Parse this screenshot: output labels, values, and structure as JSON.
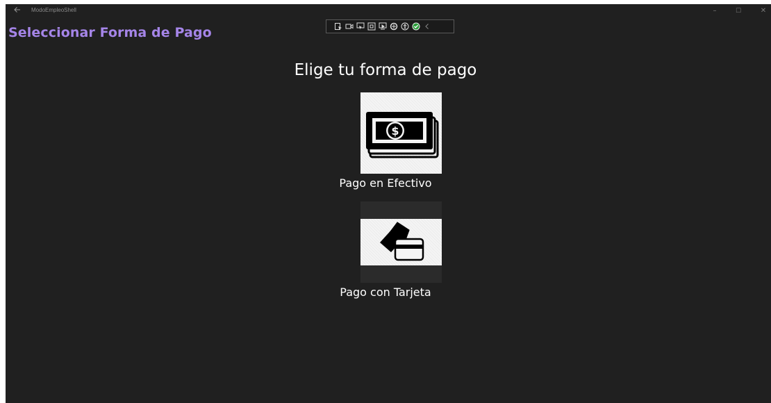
{
  "window": {
    "app_title": "ModoEmpleoShell",
    "back_icon": "back-arrow-icon",
    "controls": {
      "minimize": "–",
      "maximize": "☐",
      "close": "✕"
    }
  },
  "page": {
    "title": "Seleccionar Forma de Pago",
    "heading": "Elige tu forma de pago"
  },
  "options": [
    {
      "label": "Pago en Efectivo",
      "icon": "cash-money-icon"
    },
    {
      "label": "Pago con Tarjeta",
      "icon": "credit-card-icon"
    }
  ],
  "debug_toolbar": {
    "tools": [
      "select-element-icon",
      "display-layout-icon",
      "track-focus-icon",
      "binding-icon",
      "hot-reload-icon",
      "accessibility-scan-icon",
      "accessibility-icon",
      "checkmark-ok-icon",
      "collapse-chevron-icon"
    ]
  },
  "colors": {
    "background": "#202020",
    "title_accent": "#a585e8",
    "tile_background": "#f4f4f4"
  }
}
